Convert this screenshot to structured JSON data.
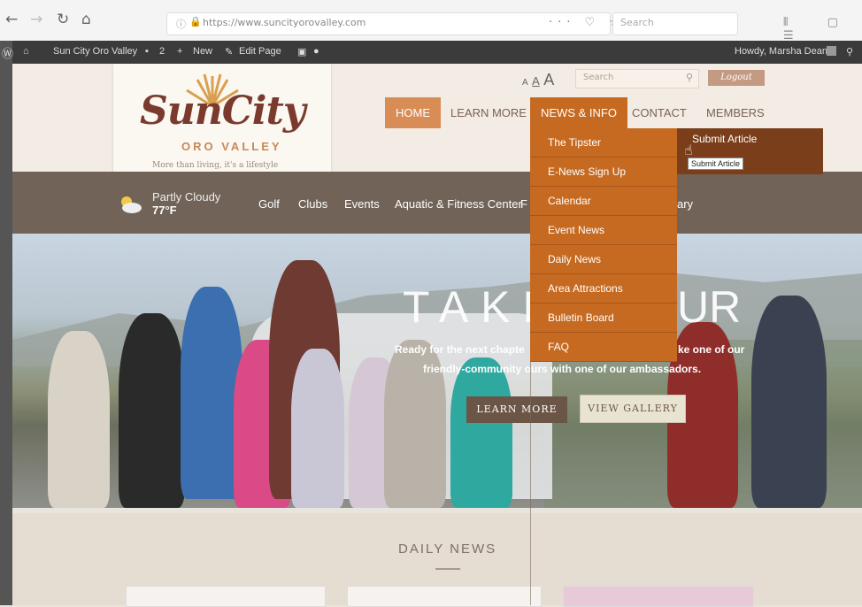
{
  "browser": {
    "url": "https://www.suncityorovalley.com",
    "search_placeholder": "Search",
    "page_actions": "··· ♡ ☆",
    "right_icons": "⫴ ▢ ☰"
  },
  "adminbar": {
    "site_name": "Sun City Oro Valley",
    "comments_count": "2",
    "new_label": "New",
    "edit_label": "Edit Page",
    "greeting": "Howdy, Marsha Dean"
  },
  "header": {
    "logo_main": "SunCity",
    "logo_sub": "ORO VALLEY",
    "logo_tagline": "More than living, it's a lifestyle",
    "text_size": {
      "small": "A",
      "medium": "A",
      "large": "A"
    },
    "search_placeholder": "Search",
    "logout_label": "Logout"
  },
  "main_nav": {
    "home": "HOME",
    "learn_more": "LEARN MORE",
    "news_info": "NEWS & INFO",
    "contact": "CONTACT",
    "members": "MEMBERS"
  },
  "weather": {
    "condition": "Partly Cloudy",
    "temp": "77°F"
  },
  "sub_nav": [
    "Golf",
    "Clubs",
    "Events",
    "Aquatic & Fitness Center",
    "F",
    "ary"
  ],
  "dropdown": {
    "items": [
      "The Tipster",
      "E-News Sign Up",
      "Calendar",
      "Event News",
      "Daily News",
      "Area Attractions",
      "Bulletin Board",
      "FAQ"
    ],
    "submenu_label": "Submit Article",
    "tooltip": "Submit Article"
  },
  "hero": {
    "title_left": "TAKE",
    "title_right": "UR",
    "sub1": "Ready for the next chapte",
    "sub1b": "ke one of our",
    "sub2": "friendly-community   ours with one of our ambassadors.",
    "learn_more": "LEARN MORE",
    "view_gallery": "VIEW GALLERY"
  },
  "daily": {
    "title": "DAILY NEWS"
  },
  "colors": {
    "accent": "#c66a21",
    "home_tab": "#d98d56",
    "subbar": "#716357",
    "submenu": "#7a3e1a"
  }
}
